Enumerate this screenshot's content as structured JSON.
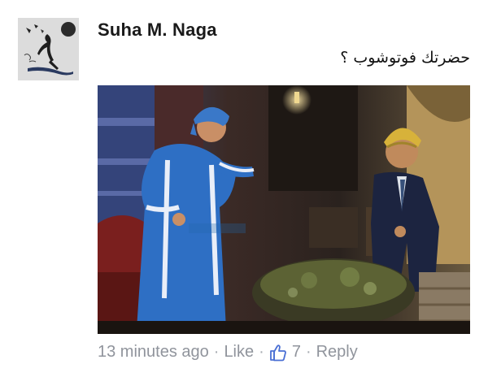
{
  "comment": {
    "author": "Suha M. Naga",
    "text": "حضرتك فوتوشوب ؟",
    "timestamp": "13 minutes ago",
    "separator": "·",
    "like_label": "Like",
    "like_count": "7",
    "reply_label": "Reply"
  },
  "icons": {
    "like_count_icon": "thumbs-up-icon"
  },
  "colors": {
    "author": "#1a1a1a",
    "meta": "#90949c"
  }
}
